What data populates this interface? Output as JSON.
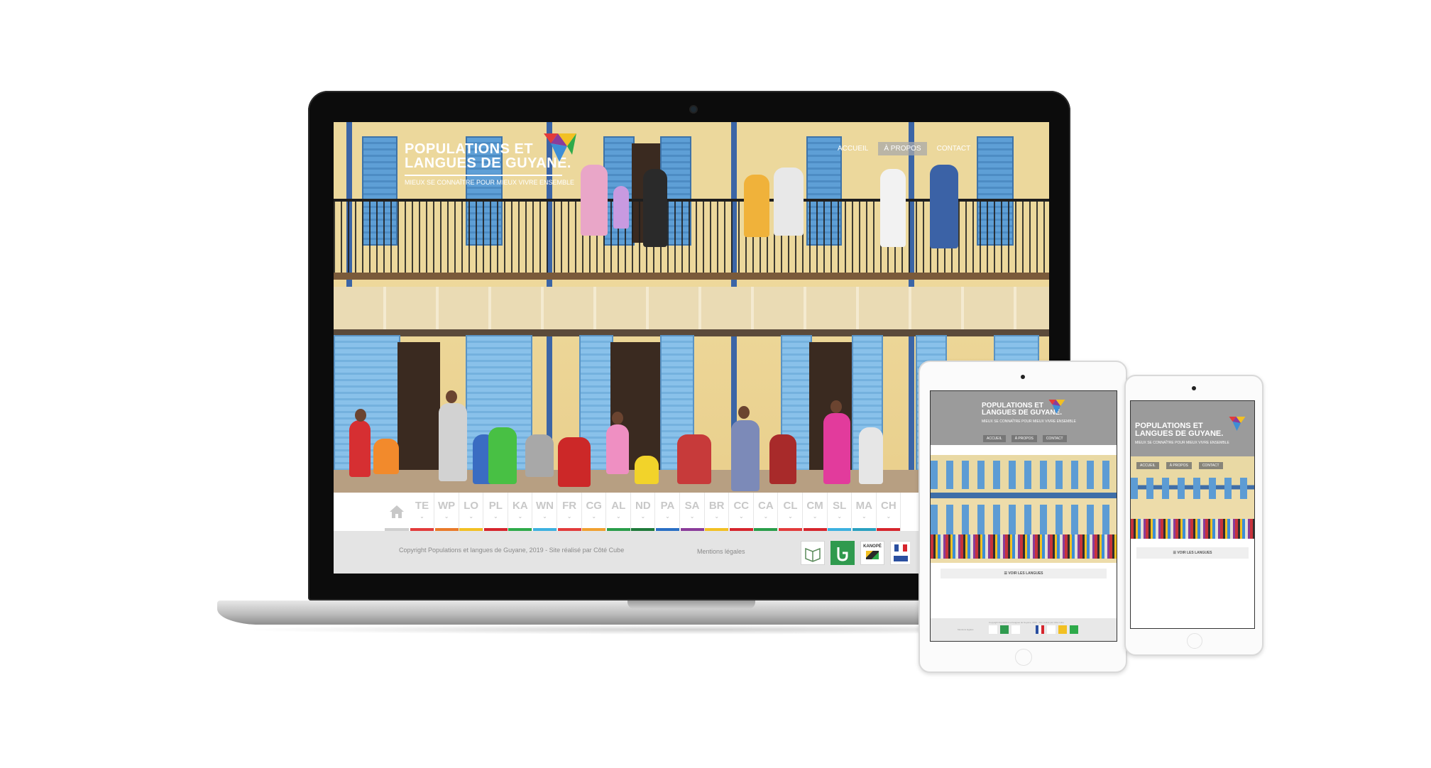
{
  "site": {
    "title_line1": "POPULATIONS ET",
    "title_line2": "LANGUES DE GUYANE.",
    "title_lines": "POPULATIONS ET\nLANGUES DE GUYANE.",
    "tagline": "MIEUX SE CONNAÎTRE POUR MIEUX VIVRE ENSEMBLE",
    "nav": [
      "ACCUEIL",
      "À PROPOS",
      "CONTACT"
    ],
    "languages": [
      {
        "code": "TE",
        "color": "#e23b3b"
      },
      {
        "code": "WP",
        "color": "#e97a2a"
      },
      {
        "code": "LO",
        "color": "#f2c023"
      },
      {
        "code": "PL",
        "color": "#d6252d"
      },
      {
        "code": "KA",
        "color": "#2eaa4a"
      },
      {
        "code": "WN",
        "color": "#3db1e0"
      },
      {
        "code": "FR",
        "color": "#e23b3b"
      },
      {
        "code": "CG",
        "color": "#f0a030"
      },
      {
        "code": "AL",
        "color": "#2a9d4a"
      },
      {
        "code": "ND",
        "color": "#1f7a3a"
      },
      {
        "code": "PA",
        "color": "#2a6fc4"
      },
      {
        "code": "SA",
        "color": "#8a3c9a"
      },
      {
        "code": "BR",
        "color": "#f2c023"
      },
      {
        "code": "CC",
        "color": "#d6252d"
      },
      {
        "code": "CA",
        "color": "#2a9d4a"
      },
      {
        "code": "CL",
        "color": "#e23b3b"
      },
      {
        "code": "CM",
        "color": "#d6252d"
      },
      {
        "code": "SL",
        "color": "#3db1e0"
      },
      {
        "code": "MA",
        "color": "#2aa0c0"
      },
      {
        "code": "CH",
        "color": "#d6252d"
      }
    ],
    "footer": {
      "copyright": "Copyright Populations et langues de Guyane, 2019 - Site réalisé par Côté Cube",
      "mentions": "Mentions légales",
      "partner_kanope": "KANOPÉ"
    },
    "mobile_button": "VOIR LES LANGUES",
    "colors": {
      "header_gray": "#9b9b9b",
      "footer_gray": "#e4e4e4",
      "blue_trim": "#3b65a6"
    }
  }
}
